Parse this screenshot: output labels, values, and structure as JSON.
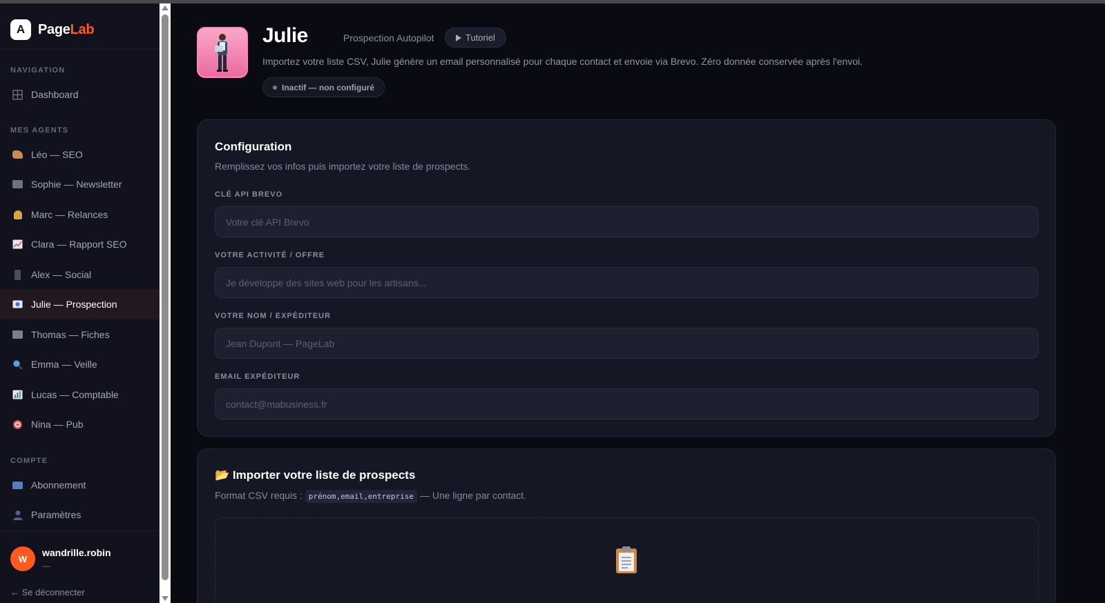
{
  "brand": {
    "logo_letter": "A",
    "name_part1": "Page",
    "name_part2": "Lab",
    "accent": "#ff5a1f"
  },
  "sidebar": {
    "section_navigation": "NAVIGATION",
    "dashboard": {
      "label": "Dashboard",
      "icon": "grid-icon"
    },
    "section_agents": "MES AGENTS",
    "agents": [
      {
        "label": "Léo — SEO",
        "icon": "writing-hand-icon"
      },
      {
        "label": "Sophie — Newsletter",
        "icon": "newspaper-icon"
      },
      {
        "label": "Marc — Relances",
        "icon": "bell-icon"
      },
      {
        "label": "Clara — Rapport SEO",
        "icon": "chart-up-icon"
      },
      {
        "label": "Alex — Social",
        "icon": "phone-icon"
      },
      {
        "label": "Julie — Prospection",
        "icon": "target-email-icon"
      },
      {
        "label": "Thomas — Fiches",
        "icon": "cards-icon"
      },
      {
        "label": "Emma — Veille",
        "icon": "magnifier-icon"
      },
      {
        "label": "Lucas — Comptable",
        "icon": "bar-chart-icon"
      },
      {
        "label": "Nina — Pub",
        "icon": "dart-target-icon"
      }
    ],
    "section_account": "COMPTE",
    "account": [
      {
        "label": "Abonnement",
        "icon": "credit-card-icon"
      },
      {
        "label": "Paramètres",
        "icon": "user-silhouette-icon"
      }
    ],
    "user": {
      "initial": "W",
      "name": "wandrille.robin",
      "sub": "—"
    },
    "logout": "← Se déconnecter"
  },
  "agent": {
    "name": "Julie",
    "role": "Prospection Autopilot",
    "tutorial_label": "Tutoriel",
    "description": "Importez votre liste CSV, Julie génère un email personnalisé pour chaque contact et envoie via Brevo. Zéro donnée conservée après l'envoi.",
    "status": "Inactif — non configuré"
  },
  "config": {
    "title": "Configuration",
    "subtitle": "Remplissez vos infos puis importez votre liste de prospects.",
    "fields": [
      {
        "label": "CLÉ API BREVO",
        "placeholder": "Votre clé API Brevo"
      },
      {
        "label": "VOTRE ACTIVITÉ / OFFRE",
        "placeholder": "Je développe des sites web pour les artisans..."
      },
      {
        "label": "VOTRE NOM / EXPÉDITEUR",
        "placeholder": "Jean Dupont — PageLab"
      },
      {
        "label": "EMAIL EXPÉDITEUR",
        "placeholder": "contact@mabusiness.fr"
      }
    ]
  },
  "import": {
    "title_icon": "📂",
    "title": "Importer votre liste de prospects",
    "format_prefix": "Format CSV requis :",
    "format_code": "prénom,email,entreprise",
    "format_suffix": "— Une ligne par contact."
  }
}
